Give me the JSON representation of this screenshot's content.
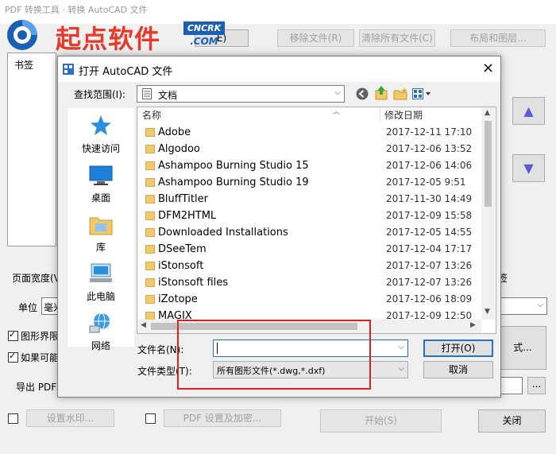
{
  "main_window": {
    "title": "PDF 转换工具 · 转换 AutoCAD 文件",
    "buttons": {
      "add_file": "E)",
      "remove_file": "移除文件(R)",
      "clear_files": "清除所有文件(C)",
      "layout": "布局和图层..."
    },
    "bookmark_label": "书签",
    "page_width_label": "页面宽度(V",
    "unit_label": "单位",
    "unit_value": "毫米",
    "right_label_partial": "签",
    "checkbox_boundary": "图形界限",
    "checkbox_if_possible": "如果可能",
    "export_pdf_label": "导出 PDF",
    "browse_button": "...",
    "format_button_partial": "式...",
    "watermark_button": "设置水印...",
    "pdf_security_button": "PDF 设置及加密...",
    "start_button": "开始(S)",
    "close_button": "关闭"
  },
  "logo": {
    "text": "起点软件",
    "badge_top": "CNCRK",
    "badge_bottom": ".COM"
  },
  "dialog": {
    "title": "打开 AutoCAD 文件",
    "close_glyph": "×",
    "look_in_label": "查找范围(I):",
    "look_in_value": "文档",
    "places": [
      {
        "label": "快速访问",
        "icon": "star-icon"
      },
      {
        "label": "桌面",
        "icon": "desktop-icon"
      },
      {
        "label": "库",
        "icon": "library-icon"
      },
      {
        "label": "此电脑",
        "icon": "computer-icon"
      },
      {
        "label": "网络",
        "icon": "network-icon"
      }
    ],
    "columns": {
      "name": "名称",
      "modified": "修改日期"
    },
    "files": [
      {
        "name": "Adobe",
        "date": "2017-12-11 17:10"
      },
      {
        "name": "Algodoo",
        "date": "2017-12-06 13:52"
      },
      {
        "name": "Ashampoo Burning Studio 15",
        "date": "2017-12-06 14:06"
      },
      {
        "name": "Ashampoo Burning Studio 19",
        "date": "2017-12-05 9:51"
      },
      {
        "name": "BluffTitler",
        "date": "2017-11-30 14:49"
      },
      {
        "name": "DFM2HTML",
        "date": "2017-12-09 15:58"
      },
      {
        "name": "Downloaded Installations",
        "date": "2017-12-05 14:55"
      },
      {
        "name": "DSeeTem",
        "date": "2017-12-04 17:17"
      },
      {
        "name": "iStonsoft",
        "date": "2017-12-07 13:26"
      },
      {
        "name": "iStonsoft files",
        "date": "2017-12-07 13:26"
      },
      {
        "name": "iZotope",
        "date": "2017-12-06 18:09"
      },
      {
        "name": "MAGIX",
        "date": "2017-12-09 12:50"
      }
    ],
    "filename_label": "文件名(N):",
    "filename_value": "",
    "filetype_label": "文件类型(T):",
    "filetype_value": "所有图形文件(*.dwg,*.dxf)",
    "open_button": "打开(O)",
    "cancel_button": "取消"
  },
  "colors": {
    "accent_blue": "#1a5fb4",
    "logo_red": "#e8392b",
    "highlight_red": "#e02020"
  }
}
